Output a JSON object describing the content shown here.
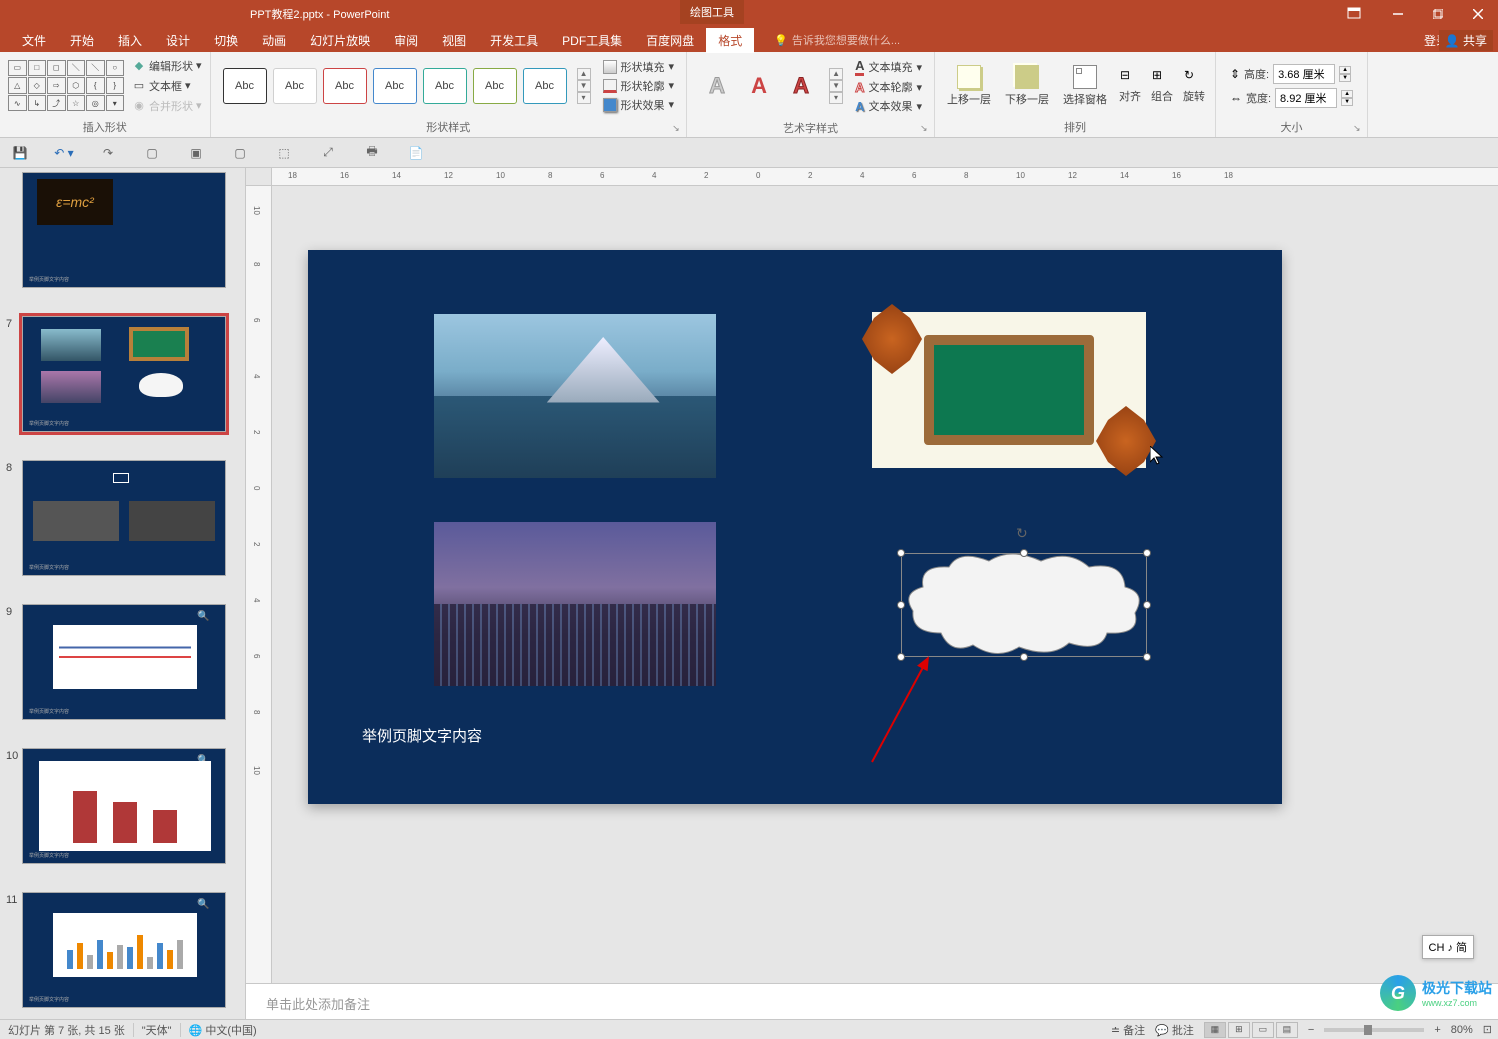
{
  "titlebar": {
    "doc_title": "PPT教程2.pptx - PowerPoint",
    "drawing_tools": "绘图工具"
  },
  "ribbon": {
    "tabs": {
      "file": "文件",
      "home": "开始",
      "insert": "插入",
      "design": "设计",
      "transitions": "切换",
      "animations": "动画",
      "slideshow": "幻灯片放映",
      "review": "审阅",
      "view": "视图",
      "developer": "开发工具",
      "pdf_tools": "PDF工具集",
      "baidu": "百度网盘",
      "format": "格式"
    },
    "tell_me": "告诉我您想要做什么...",
    "signin": "登录",
    "share": "共享"
  },
  "ribbon_format": {
    "insert_shapes": {
      "edit_shape": "编辑形状",
      "text_box": "文本框",
      "merge_shapes": "合并形状",
      "group_label": "插入形状"
    },
    "shape_styles": {
      "swatch_label": "Abc",
      "shape_fill": "形状填充",
      "shape_outline": "形状轮廓",
      "shape_effects": "形状效果",
      "group_label": "形状样式"
    },
    "wordart_styles": {
      "glyph": "A",
      "text_fill": "文本填充",
      "text_outline": "文本轮廓",
      "text_effects": "文本效果",
      "group_label": "艺术字样式"
    },
    "arrange": {
      "bring_forward": "上移一层",
      "send_backward": "下移一层",
      "selection_pane": "选择窗格",
      "align": "对齐",
      "group": "组合",
      "rotate": "旋转",
      "group_label": "排列"
    },
    "size": {
      "height_label": "高度:",
      "height_value": "3.68 厘米",
      "width_label": "宽度:",
      "width_value": "8.92 厘米",
      "group_label": "大小"
    }
  },
  "slide": {
    "footer_text": "举例页脚文字内容",
    "notes_placeholder": "单击此处添加备注"
  },
  "ruler": {
    "h_ticks": [
      "18",
      "16",
      "14",
      "12",
      "10",
      "8",
      "6",
      "4",
      "2",
      "0",
      "2",
      "4",
      "6",
      "8",
      "10",
      "12",
      "14",
      "16",
      "18"
    ],
    "v_ticks": [
      "10",
      "8",
      "6",
      "4",
      "2",
      "0",
      "2",
      "4",
      "6",
      "8",
      "10"
    ]
  },
  "thumbnails": {
    "slide6_emc": "ε=mc²",
    "footer_placeholder": "举例页脚文字内容"
  },
  "ime": {
    "badge": "CH ♪ 简"
  },
  "watermark": {
    "logo": "G",
    "cn": "极光下载站",
    "url": "www.xz7.com"
  },
  "status": {
    "slide_info": "幻灯片 第 7 张, 共 15 张",
    "theme": "\"天体\"",
    "lang": "中文(中国)",
    "notes": "备注",
    "comments": "批注",
    "zoom": "80%"
  }
}
